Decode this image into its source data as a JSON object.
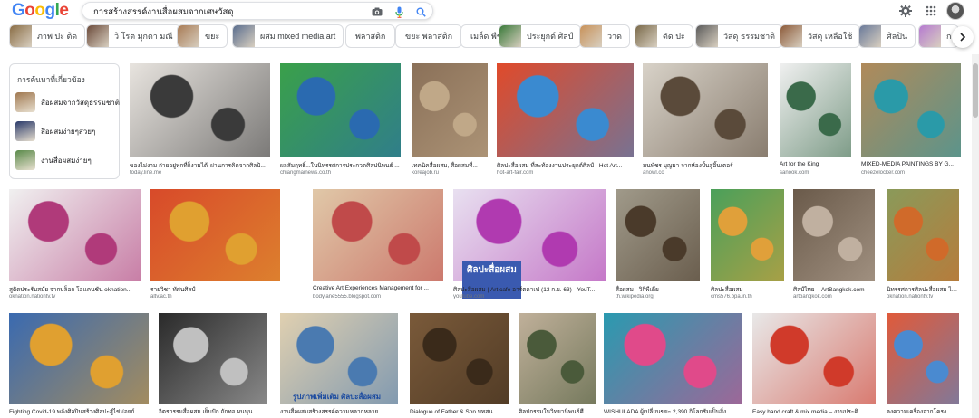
{
  "logo": {
    "letters": [
      {
        "ch": "G",
        "color": "#4285F4"
      },
      {
        "ch": "o",
        "color": "#EA4335"
      },
      {
        "ch": "o",
        "color": "#FBBC05"
      },
      {
        "ch": "g",
        "color": "#4285F4"
      },
      {
        "ch": "l",
        "color": "#34A853"
      },
      {
        "ch": "e",
        "color": "#EA4335"
      }
    ]
  },
  "search": {
    "query": "การสร้างสรรค์งานสื่อผสมจากเศษวัสดุ"
  },
  "header_icons": [
    "camera-icon",
    "microphone-icon",
    "search-icon",
    "gear-icon",
    "apps-grid-icon",
    "account-avatar"
  ],
  "chips": [
    {
      "label": "ภาพ ปะ ติด",
      "thumb": "#8a6d45"
    },
    {
      "label": "วิ โรต มุกดา มณี",
      "thumb": "#6b4a3a"
    },
    {
      "label": "ขยะ",
      "thumb": "#a87b55"
    },
    {
      "label": "ผสม mixed media art",
      "thumb": "#5a6e8e"
    },
    {
      "label": "พลาสติก",
      "thumb": null
    },
    {
      "label": "ขยะ พลาสติก",
      "thumb": null
    },
    {
      "label": "เมล็ด พืช",
      "thumb": null
    },
    {
      "label": "ประยุกต์ ศิลป์",
      "thumb": "#3a7a3a"
    },
    {
      "label": "วาด",
      "thumb": "#c8925a"
    },
    {
      "label": "ตัด ปะ",
      "thumb": "#7a6a4a"
    },
    {
      "label": "วัสดุ ธรรมชาติ",
      "thumb": "#5b5b5b"
    },
    {
      "label": "วัสดุ เหลือใช้",
      "thumb": "#8d5b3a"
    },
    {
      "label": "ศิลปิน",
      "thumb": "#6a7a9a"
    },
    {
      "label": "ก",
      "thumb": "#b57ad0"
    }
  ],
  "related": {
    "title": "การค้นหาที่เกี่ยวข้อง",
    "items": [
      {
        "label": "สื่อผสมจากวัสดุธรรมชาติ",
        "thumb": "#a07850"
      },
      {
        "label": "สื่อผสมง่ายๆสวยๆ",
        "thumb": "#2a3a6a"
      },
      {
        "label": "งานสื่อผสมง่ายๆ",
        "thumb": "#5a8a4a"
      }
    ]
  },
  "rows": [
    [
      {
        "caption": "ของไม่งาม ถ่ายอยู่ทุกที่ก็งามได้' ผ่านการคิดจากศิลปิ...",
        "source": "today.line.me",
        "colors": [
          "#e8e4df",
          "#3a3a3a"
        ]
      },
      {
        "caption": "ผลสัมฤทธิ์...ในนิทรรศการประกวดศิลปนิพนธ์ ...",
        "source": "chiangmainews.co.th",
        "colors": [
          "#3aa04a",
          "#2a6ab0"
        ]
      },
      {
        "caption": "เทคนิคสื่อผสม, สื่อผสมที่...",
        "source": "koreajob.ru",
        "colors": [
          "#8a7058",
          "#c0a888"
        ]
      },
      {
        "caption": "ศิลปะสื่อผสม ที่สะท้องงานประยุกต์ศิลป์ - Hot Art...",
        "source": "hot-art-fair.com",
        "colors": [
          "#e04a2a",
          "#3a8ad0"
        ]
      },
      {
        "caption": "มนพัชร บุญมา จากห้องปั้นสู่อิ้นเตอร์",
        "source": "anowl.co",
        "colors": [
          "#d8d2c8",
          "#5a4a3a"
        ]
      },
      {
        "caption": "Art for the King",
        "source": "sanook.com",
        "colors": [
          "#f0f0f0",
          "#3a6a4a"
        ]
      },
      {
        "caption": "MIXED-MEDIA PAINTINGS BY G...",
        "source": "cheezelocker.com",
        "colors": [
          "#b08a5a",
          "#2a9aa8"
        ]
      }
    ],
    [
      {
        "caption": "สูติดประรับสมัย จากบล็อก โอแคนชัน oknation...",
        "source": "oknation.nationtv.tv",
        "colors": [
          "#f0f0f0",
          "#b03a7a"
        ]
      },
      {
        "caption": "รายวิชา ทัศนศิลป์",
        "source": "altv.ac.th",
        "colors": [
          "#d84a2a",
          "#e0a030"
        ]
      },
      {
        "caption": "Creative Art Experiences Management for ...",
        "source": "bodylane5555.blogspot.com",
        "colors": [
          "#e0c8a8",
          "#c04a4a"
        ]
      },
      {
        "caption": "ศิลปะสื่อผสม | Art cafe อาร์ตคาเฟ่ (13 ก.ย. 63) - YouT...",
        "source": "youtube.com",
        "colors": [
          "#e8e0f0",
          "#b03ab0"
        ],
        "overlay": "ศิลปะสื่อผสม"
      },
      {
        "caption": "สื่อผสม - วิกิพีเดีย",
        "source": "th.wikipedia.org",
        "colors": [
          "#a09a8a",
          "#4a3a2a"
        ]
      },
      {
        "caption": "ศิลปะสื่อผสม",
        "source": "cms576.bpa.in.th",
        "colors": [
          "#4aa05a",
          "#e0a03a"
        ]
      },
      {
        "caption": "ศิลป์ไทย – ArtBangkok.com",
        "source": "artbangkok.com",
        "colors": [
          "#6a5a4a",
          "#c0b0a0"
        ]
      },
      {
        "caption": "นิทรรศการศิลปะสื่อผสม ไร้ร...",
        "source": "oknation.nationtv.tv",
        "colors": [
          "#8a9a5a",
          "#d06a2a"
        ]
      }
    ],
    [
      {
        "caption": "Fighting Covid-19 พลังศิลปินสร้างศิลปะสู้ไข่ม่อยก์...",
        "source": "",
        "colors": [
          "#3a6ab0",
          "#e0a030"
        ]
      },
      {
        "caption": "จิตรกรรมสื่อผสม เย็บปัก ถักทอ ผนนุน...",
        "source": "",
        "colors": [
          "#2a2a2a",
          "#c0c0c0"
        ]
      },
      {
        "caption": "งานสื่อผสมสร้างสรรค์ความหลากหลาย",
        "source": "",
        "colors": [
          "#e0d0b0",
          "#4a7ab0"
        ],
        "overlay": "รูปภาพเพิ่มเติม ศิลปะสื่อผสม"
      },
      {
        "caption": "Dialogue of Father & Son บทสน...",
        "source": "",
        "colors": [
          "#7a5a3a",
          "#3a2a1a"
        ]
      },
      {
        "caption": "ศิลปกรรมในวิทยานิพนธ์ศี...",
        "source": "",
        "colors": [
          "#c0b09a",
          "#4a5a3a"
        ]
      },
      {
        "caption": "WISHULADA ผู้เปลี่ยนขยะ 2,390 กิโลกรัมเป็นสิ่ง...",
        "source": "",
        "colors": [
          "#2a9ab0",
          "#e04a8a"
        ]
      },
      {
        "caption": "Easy hand craft & mix media – งานประดิ...",
        "source": "",
        "colors": [
          "#e8e8e8",
          "#d03a2a"
        ]
      },
      {
        "caption": "ลงความเครื่องจากโครง...",
        "source": "",
        "colors": [
          "#e05a3a",
          "#4a8ad0"
        ]
      }
    ]
  ]
}
